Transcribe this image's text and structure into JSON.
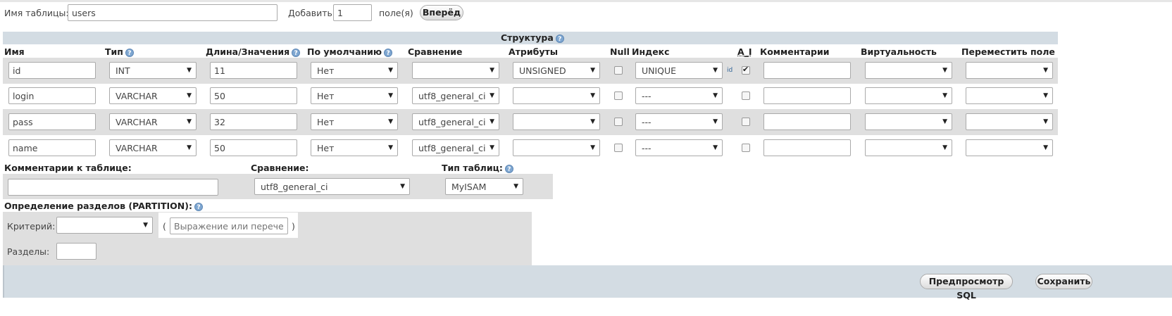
{
  "top": {
    "table_name_label": "Имя таблицы:",
    "table_name_value": "users",
    "add_label": "Добавить",
    "add_value": "1",
    "fields_label": "поле(я)",
    "go_button": "Вперёд"
  },
  "structure": {
    "title": "Структура",
    "columns": [
      "Имя",
      "Тип",
      "Длина/Значения",
      "По умолчанию",
      "Сравнение",
      "Атрибуты",
      "Null",
      "Индекс",
      "A_I",
      "Комментарии",
      "Виртуальность",
      "Переместить поле"
    ],
    "rows": [
      {
        "name": "id",
        "type": "INT",
        "length": "11",
        "default": "Нет",
        "collation": "",
        "attributes": "UNSIGNED",
        "null": false,
        "index": "UNIQUE",
        "index_note": "id",
        "ai": true,
        "comment": "",
        "virtuality": "",
        "move": ""
      },
      {
        "name": "login",
        "type": "VARCHAR",
        "length": "50",
        "default": "Нет",
        "collation": "utf8_general_ci",
        "attributes": "",
        "null": false,
        "index": "---",
        "index_note": "",
        "ai": false,
        "comment": "",
        "virtuality": "",
        "move": ""
      },
      {
        "name": "pass",
        "type": "VARCHAR",
        "length": "32",
        "default": "Нет",
        "collation": "utf8_general_ci",
        "attributes": "",
        "null": false,
        "index": "---",
        "index_note": "",
        "ai": false,
        "comment": "",
        "virtuality": "",
        "move": ""
      },
      {
        "name": "name",
        "type": "VARCHAR",
        "length": "50",
        "default": "Нет",
        "collation": "utf8_general_ci",
        "attributes": "",
        "null": false,
        "index": "---",
        "index_note": "",
        "ai": false,
        "comment": "",
        "virtuality": "",
        "move": ""
      }
    ]
  },
  "table_options": {
    "comment_label": "Комментарии к таблице:",
    "comment_value": "",
    "collation_label": "Сравнение:",
    "collation_value": "utf8_general_ci",
    "engine_label": "Тип таблиц:",
    "engine_value": "MyISAM"
  },
  "partition": {
    "title": "Определение разделов (PARTITION):",
    "criterion_label": "Критерий:",
    "criterion_value": "",
    "open_paren": "(",
    "expression_placeholder": "Выражение или перечень с",
    "close_paren": ")",
    "partitions_label": "Разделы:",
    "partitions_value": ""
  },
  "footer": {
    "preview_button": "Предпросмотр SQL",
    "save_button": "Сохранить"
  },
  "colors": {
    "section_bg": "#d3dce3",
    "row_bg": "#dfdfdf",
    "help_icon": "#7fa7d1"
  }
}
